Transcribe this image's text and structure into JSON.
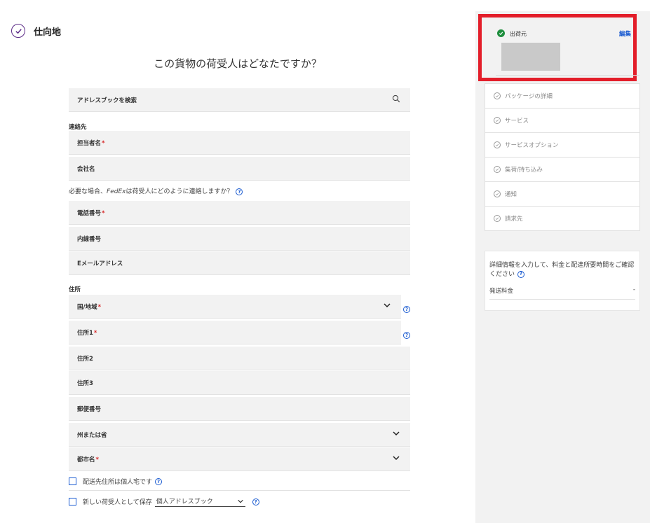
{
  "section": {
    "title": "仕向地"
  },
  "question": "この貨物の荷受人はどなたですか？",
  "address_book": {
    "search_label": "アドレスブックを検索"
  },
  "contact": {
    "group_label": "連絡先",
    "contact_name_label": "担当者名",
    "company_label": "会社名",
    "hint_prefix": "必要な場合、",
    "hint_brand": "FedEx",
    "hint_suffix": "は荷受人にどのように連絡しますか？",
    "phone_label": "電話番号",
    "extension_label": "内線番号",
    "email_label": "Eメールアドレス"
  },
  "address": {
    "group_label": "住所",
    "country_label": "国/地域",
    "address1_label": "住所1",
    "address2_label": "住所2",
    "address3_label": "住所3",
    "postal_label": "郵便番号",
    "state_label": "州または省",
    "city_label": "都市名"
  },
  "required_mark": "*",
  "help_glyph": "?",
  "checkboxes": {
    "residential_label": "配送先住所は個人宅です",
    "save_label": "新しい荷受人として保存",
    "save_target": "個人アドレスブック"
  },
  "sidebar": {
    "ship_from_label": "出荷元",
    "edit_label": "編集",
    "steps": [
      {
        "label": "パッケージの詳細"
      },
      {
        "label": "サービス"
      },
      {
        "label": "サービスオプション"
      },
      {
        "label": "集荷/持ち込み"
      },
      {
        "label": "通知"
      },
      {
        "label": "請求先"
      }
    ],
    "quote_message": "詳細情報を入力して、料金と配達所要時間をご確認ください",
    "rate_label": "発送料金",
    "rate_value": "-"
  },
  "colors": {
    "accent": "#1a5bd1",
    "highlight_border": "#e31e2a",
    "check_green": "#1e8e3e",
    "brand_purple": "#5a2a86"
  }
}
